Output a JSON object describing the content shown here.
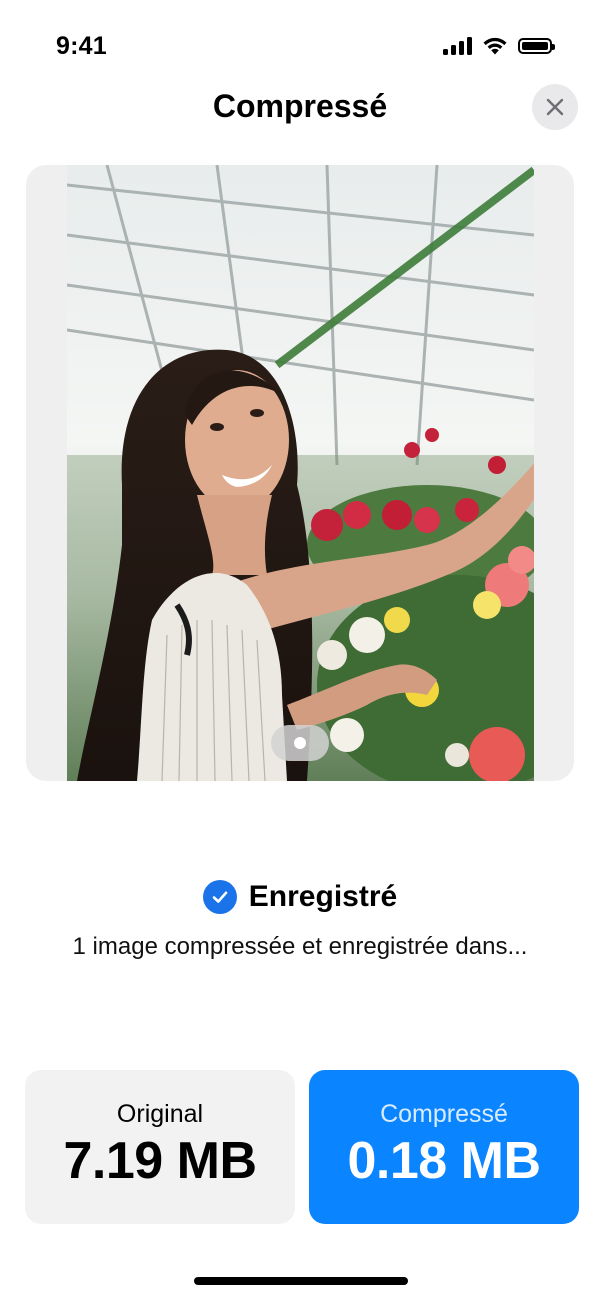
{
  "status_bar": {
    "time": "9:41",
    "icons": [
      "cellular-signal-icon",
      "wifi-icon",
      "battery-icon"
    ]
  },
  "header": {
    "title": "Compressé",
    "close_icon": "close-icon"
  },
  "preview": {
    "image_description_icon": "photo",
    "page_count": 1,
    "current_page": 1
  },
  "result": {
    "status_icon": "checkmark-circle-icon",
    "title": "Enregistré",
    "subtitle": "1 image compressée et enregistrée dans..."
  },
  "sizes": {
    "original": {
      "label": "Original",
      "value": "7.19 MB"
    },
    "compressed": {
      "label": "Compressé",
      "value": "0.18 MB"
    }
  },
  "colors": {
    "accent": "#0a84ff",
    "check": "#1a73e8",
    "card_bg": "#f2f2f2"
  }
}
